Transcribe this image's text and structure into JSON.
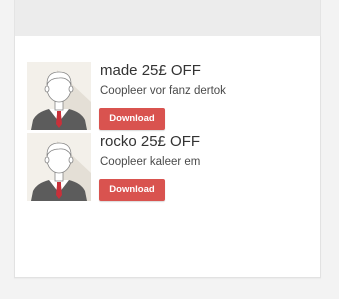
{
  "offers": [
    {
      "title": "made 25£ OFF",
      "description": "Coopleer vor fanz dertok",
      "button_label": "Download",
      "avatar_icon": "person-avatar-icon"
    },
    {
      "title": "rocko 25£ OFF",
      "description": "Coopleer kaleer em",
      "button_label": "Download",
      "avatar_icon": "person-avatar-icon"
    }
  ],
  "colors": {
    "button": "#d9534f",
    "tie": "#c9303a",
    "background": "#f3f3f3",
    "card": "#ffffff"
  }
}
